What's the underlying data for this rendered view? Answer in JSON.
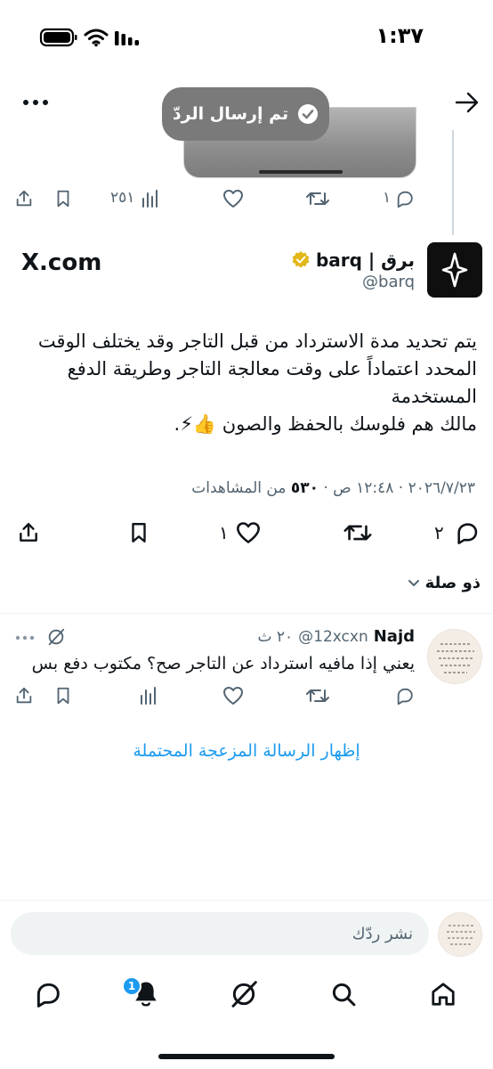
{
  "status_bar": {
    "time": "١:٣٧"
  },
  "toast": {
    "text": "تم إرسال الردّ"
  },
  "quoted_actions": {
    "replies": "١",
    "views": "٢٥١"
  },
  "link_card": {
    "domain": "X.com"
  },
  "author": {
    "name": "برق | barq",
    "handle": "@barq"
  },
  "tweet": {
    "lines": [
      "يتم تحديد مدة الاسترداد من قبل التاجر وقد يختلف الوقت",
      "المحدد اعتماداً على وقت معالجة التاجر وطريقة الدفع",
      "المستخدمة",
      "مالك هم فلوسك بالحفظ والصون 👍⚡."
    ],
    "meta_prefix": "٢٠٢٦/٧/٢٣ · ١٢:٤٨ ص · ",
    "views_count": "٥٣٠",
    "views_label": " من المشاهدات",
    "replies": "٢",
    "likes": "١"
  },
  "related": {
    "label": "ذو صلة"
  },
  "reply": {
    "name": "Najd",
    "handle": "@12xcxn",
    "time": "٢٠ ث",
    "text": "يعني إذا مافيه استرداد عن التاجر صح؟ مكتوب دفع بس"
  },
  "spam": {
    "link": "إظهار الرسالة المزعجة المحتملة"
  },
  "composer": {
    "placeholder": "نشر ردّك"
  },
  "bottom_nav": {
    "notifications_badge": "1"
  },
  "colors": {
    "link": "#1d9bf0",
    "muted": "#536471",
    "verified": "#e2b719"
  }
}
